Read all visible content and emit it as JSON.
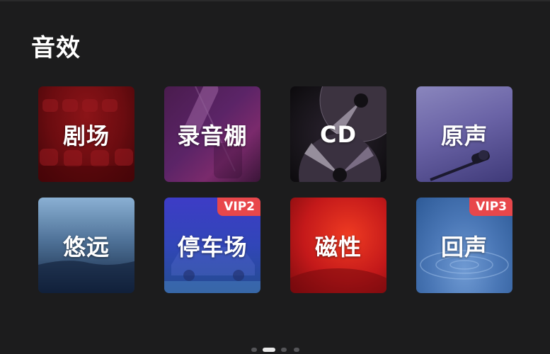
{
  "page": {
    "title": "音效"
  },
  "effects": [
    {
      "label": "剧场",
      "badge": ""
    },
    {
      "label": "录音棚",
      "badge": ""
    },
    {
      "label": "CD",
      "badge": ""
    },
    {
      "label": "原声",
      "badge": ""
    },
    {
      "label": "悠远",
      "badge": ""
    },
    {
      "label": "停车场",
      "badge": "VIP2"
    },
    {
      "label": "磁性",
      "badge": ""
    },
    {
      "label": "回声",
      "badge": "VIP3"
    }
  ],
  "pagination": {
    "pages": 4,
    "active_index": 1
  },
  "colors": {
    "background": "#1c1c1d",
    "badge": "#e8474b",
    "dot_active": "#e8e8e8",
    "dot_inactive": "#555558"
  }
}
